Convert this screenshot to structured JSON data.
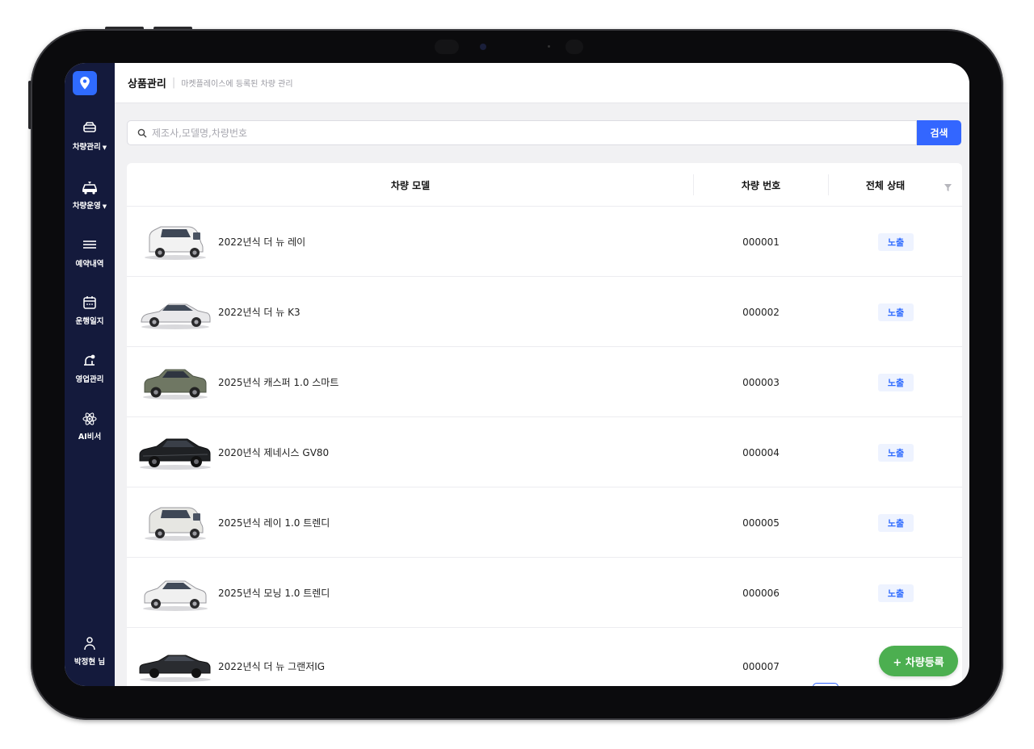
{
  "header": {
    "title": "상품관리",
    "separator": "|",
    "subtitle": "마켓플레이스에 등록된 차량 관리"
  },
  "sidebar": {
    "items": [
      {
        "label": "차량관리",
        "icon": "car-icon",
        "has_dropdown": true
      },
      {
        "label": "차량운영",
        "icon": "car-operation-icon",
        "has_dropdown": true
      },
      {
        "label": "예약내역",
        "icon": "menu-lines-icon",
        "has_dropdown": false
      },
      {
        "label": "운행일지",
        "icon": "calendar-icon",
        "has_dropdown": false
      },
      {
        "label": "영업관리",
        "icon": "bell-alert-icon",
        "has_dropdown": false
      },
      {
        "label": "AI비서",
        "icon": "ai-atom-icon",
        "has_dropdown": false
      }
    ],
    "user": {
      "label": "박정현 님",
      "icon": "user-icon"
    }
  },
  "search": {
    "placeholder": "제조사,모델명,차량번호",
    "button_label": "검색"
  },
  "table": {
    "columns": [
      "차량 모델",
      "차량 번호",
      "전체 상태"
    ],
    "rows": [
      {
        "model": "2022년식 더 뉴 레이",
        "number": "000001",
        "status": "노출"
      },
      {
        "model": "2022년식 더 뉴 K3",
        "number": "000002",
        "status": "노출"
      },
      {
        "model": "2025년식 캐스퍼 1.0 스마트",
        "number": "000003",
        "status": "노출"
      },
      {
        "model": "2020년식 제네시스 GV80",
        "number": "000004",
        "status": "노출"
      },
      {
        "model": "2025년식 레이 1.0 트렌디",
        "number": "000005",
        "status": "노출"
      },
      {
        "model": "2025년식 모닝 1.0 트렌디",
        "number": "000006",
        "status": "노출"
      },
      {
        "model": "2022년식 더 뉴 그랜저IG",
        "number": "000007",
        "status": ""
      }
    ]
  },
  "fab": {
    "label": "+ 차량등록"
  },
  "colors": {
    "sidebar_bg": "#141a3c",
    "accent_blue": "#3366ff",
    "badge_text": "#2f6bff",
    "fab_green": "#4caf50"
  }
}
